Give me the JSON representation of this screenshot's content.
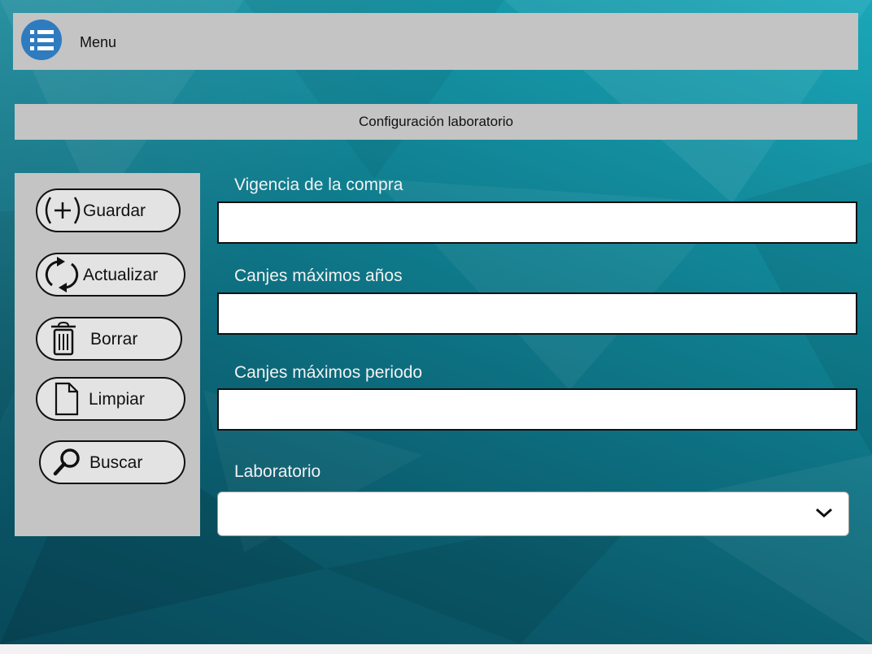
{
  "menu": {
    "label": "Menu",
    "icon": "list-icon",
    "accent": "#2f7bc0"
  },
  "section": {
    "title": "Configuración laboratorio"
  },
  "actions": [
    {
      "label": "Guardar",
      "icon": "add-circle-icon"
    },
    {
      "label": "Actualizar",
      "icon": "refresh-icon"
    },
    {
      "label": "Borrar",
      "icon": "trash-icon"
    },
    {
      "label": "Limpiar",
      "icon": "document-icon"
    },
    {
      "label": "Buscar",
      "icon": "search-icon"
    }
  ],
  "form": {
    "vigencia": {
      "label": "Vigencia de la compra",
      "value": ""
    },
    "canjes_anios": {
      "label": "Canjes máximos años",
      "value": ""
    },
    "canjes_periodo": {
      "label": "Canjes máximos periodo",
      "value": ""
    },
    "laboratorio": {
      "label": "Laboratorio",
      "selected": ""
    }
  }
}
